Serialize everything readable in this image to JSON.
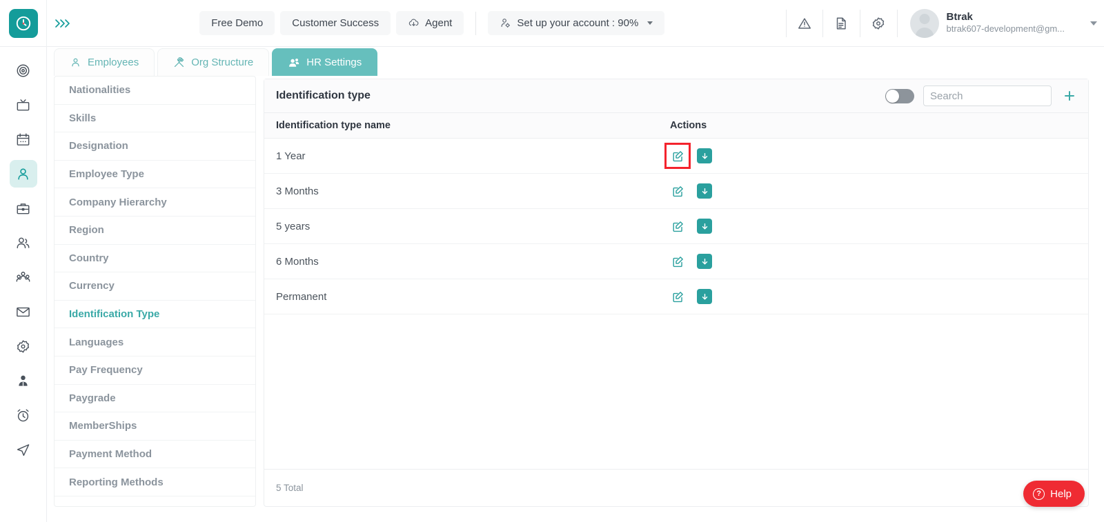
{
  "brand": {
    "accent": "#149c9a",
    "accent_light": "#66bfbd",
    "danger": "#ef2b33",
    "logo_icon": "clock-icon",
    "expander_glyph": "〉〉〉"
  },
  "header": {
    "nav_buttons": [
      {
        "label": "Free Demo",
        "icon": null
      },
      {
        "label": "Customer Success",
        "icon": null
      },
      {
        "label": "Agent",
        "icon": "cloud-download-icon"
      },
      {
        "label": "Set up your account : 90%",
        "icon": "user-settings-icon",
        "has_caret": true
      }
    ],
    "icons": [
      "warning-triangle-icon",
      "document-icon",
      "gear-icon"
    ],
    "user": {
      "name": "Btrak",
      "email": "btrak607-development@gm..."
    }
  },
  "rail": {
    "items": [
      {
        "name": "target-icon",
        "active": false
      },
      {
        "name": "tv-icon",
        "active": false
      },
      {
        "name": "calendar-icon",
        "active": false
      },
      {
        "name": "person-icon",
        "active": true
      },
      {
        "name": "briefcase-icon",
        "active": false
      },
      {
        "name": "users-icon",
        "active": false
      },
      {
        "name": "team-icon",
        "active": false
      },
      {
        "name": "mail-icon",
        "active": false
      },
      {
        "name": "gear-icon",
        "active": false
      },
      {
        "name": "profile-icon",
        "active": false
      },
      {
        "name": "alarm-clock-icon",
        "active": false
      },
      {
        "name": "send-icon",
        "active": false
      }
    ]
  },
  "tabs": [
    {
      "label": "Employees",
      "icon": "person-icon",
      "active": false
    },
    {
      "label": "Org Structure",
      "icon": "tools-icon",
      "active": false
    },
    {
      "label": "HR Settings",
      "icon": "people-icon",
      "active": true
    }
  ],
  "settings_list": [
    {
      "label": "Nationalities",
      "active": false
    },
    {
      "label": "Skills",
      "active": false
    },
    {
      "label": "Designation",
      "active": false
    },
    {
      "label": "Employee Type",
      "active": false
    },
    {
      "label": "Company Hierarchy",
      "active": false
    },
    {
      "label": "Region",
      "active": false
    },
    {
      "label": "Country",
      "active": false
    },
    {
      "label": "Currency",
      "active": false
    },
    {
      "label": "Identification Type",
      "active": true
    },
    {
      "label": "Languages",
      "active": false
    },
    {
      "label": "Pay Frequency",
      "active": false
    },
    {
      "label": "Paygrade",
      "active": false
    },
    {
      "label": "MemberShips",
      "active": false
    },
    {
      "label": "Payment Method",
      "active": false
    },
    {
      "label": "Reporting Methods",
      "active": false
    }
  ],
  "panel": {
    "title": "Identification type",
    "toggle_on": false,
    "search_placeholder": "Search",
    "search_value": "",
    "add_icon": "plus-icon",
    "columns": {
      "name": "Identification type name",
      "actions": "Actions"
    },
    "rows": [
      {
        "name": "1 Year",
        "highlighted": true
      },
      {
        "name": "3 Months",
        "highlighted": false
      },
      {
        "name": "5 years",
        "highlighted": false
      },
      {
        "name": "6 Months",
        "highlighted": false
      },
      {
        "name": "Permanent",
        "highlighted": false
      }
    ],
    "footer": "5 Total"
  },
  "help": {
    "label": "Help",
    "icon": "question-circle-icon"
  }
}
